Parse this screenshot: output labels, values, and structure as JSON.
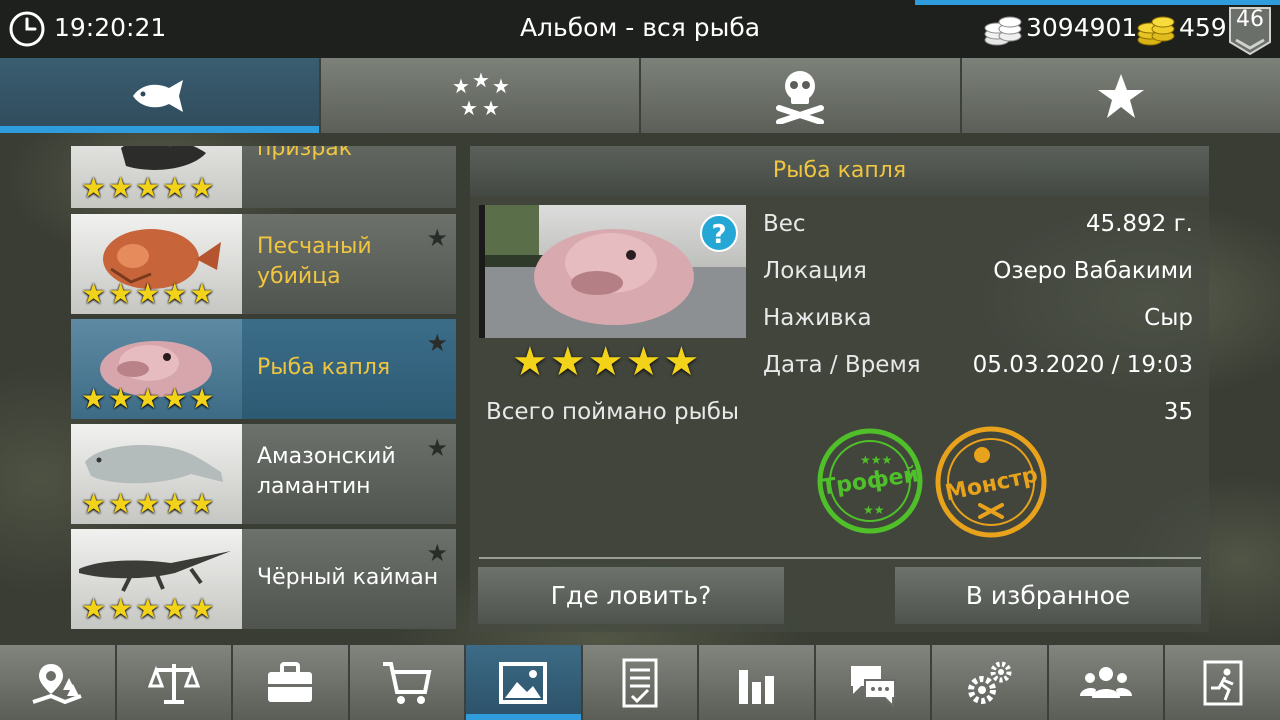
{
  "status": {
    "time": "19:20:21",
    "title": "Альбом - вся рыба",
    "coins": "3094901",
    "gold": "459",
    "level": "46"
  },
  "tabs": [
    {
      "icon": "fish-icon",
      "active": true
    },
    {
      "icon": "stars-icon",
      "active": false
    },
    {
      "icon": "skull-crossbones-icon",
      "active": false
    },
    {
      "icon": "star-icon",
      "active": false
    }
  ],
  "fish_list": [
    {
      "name": "Каменный призрак",
      "stars": "★★★★★",
      "favorite": false,
      "active": false
    },
    {
      "name": "Песчаный убийца",
      "stars": "★★★★★",
      "favorite": true,
      "active": false
    },
    {
      "name": "Рыба капля",
      "stars": "★★★★★",
      "favorite": true,
      "active": true
    },
    {
      "name": "Амазонский ламантин",
      "stars": "★★★★★",
      "favorite": true,
      "active": false
    },
    {
      "name": "Чёрный кайман",
      "stars": "★★★★★",
      "favorite": true,
      "active": false
    }
  ],
  "detail": {
    "name": "Рыба капля",
    "stars": "★★★★★",
    "help": "?",
    "rows": [
      {
        "label": "Вес",
        "value": "45.892 г."
      },
      {
        "label": "Локация",
        "value": "Озеро Вабакими"
      },
      {
        "label": "Наживка",
        "value": "Сыр"
      },
      {
        "label": "Дата / Время",
        "value": "05.03.2020 / 19:03"
      }
    ],
    "total_label": "Всего поймано рыбы",
    "total_value": "35",
    "badges": {
      "trophy": "Трофей",
      "monster": "Монстр"
    },
    "where_button": "Где ловить?",
    "favorite_button": "В избранное"
  },
  "bottom_nav": [
    "map-icon",
    "scales-icon",
    "briefcase-icon",
    "cart-icon",
    "gallery-icon",
    "checklist-icon",
    "bar-chart-icon",
    "chat-icon",
    "gears-icon",
    "people-icon",
    "exit-icon"
  ],
  "colors": {
    "accent": "#2f9ddd",
    "gold_text": "#f0c540",
    "star": "#f3d31a",
    "trophy_stamp": "#4fc02a",
    "monster_stamp": "#e8a21c"
  }
}
